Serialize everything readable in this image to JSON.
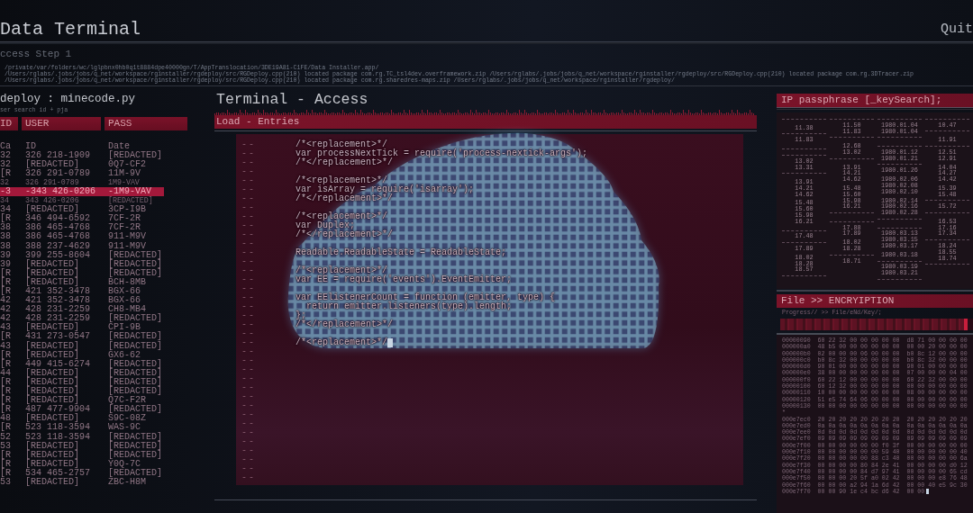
{
  "header": {
    "title": "Data Terminal",
    "quit": "Quit",
    "step": "ccess Step 1",
    "log_lines": [
      "/private/var/folders/wc/lglpbnx0hb0q1t8884dpe40000gn/T/AppTranslocation/3DE19A81-C1FE/Data Installer.app/",
      "/Users/rglabs/.jobs/jobs/q_net/workspace/rginstaller/rgdeploy/src/RGDeploy.cpp(210) located package com.rg.TC_tsl4dev.overframework.zip /Users/rglabs/.jobs/jobs/q_net/workspace/rginstaller/rgdeploy/src/RGDeploy.cpp(210) located package com.rg.3DTracer.zip",
      "/Users/rglabs/.jobs/jobs/q_net/workspace/rginstaller/rgdeploy/src/RGDeploy.cpp(210) located package com.rg.sharedres-maps.zip /Users/rglabs/.jobs/jobs/q_net/workspace/rginstaller/rgdeploy/"
    ]
  },
  "left_panel": {
    "title": "deploy : minecode.py",
    "subtitle": "ser search id + pja",
    "columns": [
      "ID",
      "USER",
      "PASS"
    ],
    "rows": [
      {
        "cells": [
          "Ca",
          "ID",
          "Date"
        ],
        "selected": false,
        "faint": false
      },
      {
        "cells": [
          "32",
          "326 218-1909",
          "[REDACTED]"
        ],
        "selected": false,
        "faint": false
      },
      {
        "cells": [
          "32",
          "[REDACTED]",
          "0Q7-CF2"
        ],
        "selected": false,
        "faint": false
      },
      {
        "cells": [
          "[R",
          "326 291-0789",
          "11M-9V"
        ],
        "selected": false,
        "faint": false
      },
      {
        "cells": [
          "32",
          "326 291-0789",
          "1M9-VAV"
        ],
        "selected": false,
        "faint": true
      },
      {
        "cells": [
          "-3",
          "-343 426-0206",
          "-1M9-VAV"
        ],
        "selected": true,
        "faint": false
      },
      {
        "cells": [
          "34",
          "343 426-0206",
          "[REDACTED]"
        ],
        "selected": false,
        "faint": true
      },
      {
        "cells": [
          "34",
          "[REDACTED]",
          "3CP-I9B"
        ],
        "selected": false,
        "faint": false
      },
      {
        "cells": [
          "[R",
          "346 494-6592",
          "7CF-2R"
        ],
        "selected": false,
        "faint": false
      },
      {
        "cells": [
          "38",
          "386 465-4768",
          "7CF-2R"
        ],
        "selected": false,
        "faint": false
      },
      {
        "cells": [
          "38",
          "386 465-4768",
          "911-M9V"
        ],
        "selected": false,
        "faint": false
      },
      {
        "cells": [
          "38",
          "388 237-4629",
          "911-M9V"
        ],
        "selected": false,
        "faint": false
      },
      {
        "cells": [
          "39",
          "399 255-8604",
          "[REDACTED]"
        ],
        "selected": false,
        "faint": false
      },
      {
        "cells": [
          "39",
          "[REDACTED]",
          "[REDACTED]"
        ],
        "selected": false,
        "faint": false
      },
      {
        "cells": [
          "[R",
          "[REDACTED]",
          "[REDACTED]"
        ],
        "selected": false,
        "faint": false
      },
      {
        "cells": [
          "[R",
          "[REDACTED]",
          "BCH-8MB"
        ],
        "selected": false,
        "faint": false
      },
      {
        "cells": [
          "[R",
          "421 352-3478",
          "BGX-66"
        ],
        "selected": false,
        "faint": false
      },
      {
        "cells": [
          "42",
          "421 352-3478",
          "BGX-66"
        ],
        "selected": false,
        "faint": false
      },
      {
        "cells": [
          "42",
          "428 231-2259",
          "CH8-MB4"
        ],
        "selected": false,
        "faint": false
      },
      {
        "cells": [
          "42",
          "428 231-2259",
          "[REDACTED]"
        ],
        "selected": false,
        "faint": false
      },
      {
        "cells": [
          "43",
          "[REDACTED]",
          "CPI-9B"
        ],
        "selected": false,
        "faint": false
      },
      {
        "cells": [
          "[R",
          "431 273-0547",
          "[REDACTED]"
        ],
        "selected": false,
        "faint": false
      },
      {
        "cells": [
          "43",
          "[REDACTED]",
          "[REDACTED]"
        ],
        "selected": false,
        "faint": false
      },
      {
        "cells": [
          "[R",
          "[REDACTED]",
          "GX6-62"
        ],
        "selected": false,
        "faint": false
      },
      {
        "cells": [
          "[R",
          "449 415-6274",
          "[REDACTED]"
        ],
        "selected": false,
        "faint": false
      },
      {
        "cells": [
          "44",
          "[REDACTED]",
          "[REDACTED]"
        ],
        "selected": false,
        "faint": false
      },
      {
        "cells": [
          "[R",
          "[REDACTED]",
          "[REDACTED]"
        ],
        "selected": false,
        "faint": false
      },
      {
        "cells": [
          "[R",
          "[REDACTED]",
          "[REDACTED]"
        ],
        "selected": false,
        "faint": false
      },
      {
        "cells": [
          "[R",
          "[REDACTED]",
          "Q7C-F2R"
        ],
        "selected": false,
        "faint": false
      },
      {
        "cells": [
          "[R",
          "487 477-9904",
          "[REDACTED]"
        ],
        "selected": false,
        "faint": false
      },
      {
        "cells": [
          "48",
          "[REDACTED]",
          "S9C-08Z"
        ],
        "selected": false,
        "faint": false
      },
      {
        "cells": [
          "[R",
          "523 118-3594",
          "WAS-9C"
        ],
        "selected": false,
        "faint": false
      },
      {
        "cells": [
          "52",
          "523 118-3594",
          "[REDACTED]"
        ],
        "selected": false,
        "faint": false
      },
      {
        "cells": [
          "53",
          "[REDACTED]",
          "[REDACTED]"
        ],
        "selected": false,
        "faint": false
      },
      {
        "cells": [
          "[R",
          "[REDACTED]",
          "[REDACTED]"
        ],
        "selected": false,
        "faint": false
      },
      {
        "cells": [
          "[R",
          "[REDACTED]",
          "Y0Q-7C"
        ],
        "selected": false,
        "faint": false
      },
      {
        "cells": [
          "[R",
          "534 465-2757",
          "[REDACTED]"
        ],
        "selected": false,
        "faint": false
      },
      {
        "cells": [
          "53",
          "[REDACTED]",
          "ZBC-H8M"
        ],
        "selected": false,
        "faint": false
      }
    ]
  },
  "terminal": {
    "title": "Terminal - Access",
    "bar": "Load - Entries",
    "lines": [
      {
        "gutter": "--",
        "code": "/*<replacement>*/",
        "cursor": false
      },
      {
        "gutter": "--",
        "code": "var processNextTick = require('process-nextick-args');",
        "cursor": false
      },
      {
        "gutter": "--",
        "code": "/*</replacement>*/",
        "cursor": false
      },
      {
        "gutter": "--",
        "cursor": false
      },
      {
        "gutter": "--",
        "code": "/*<replacement>*/",
        "cursor": false
      },
      {
        "gutter": "--",
        "code": "var isArray = require('isarray');",
        "cursor": false
      },
      {
        "gutter": "--",
        "code": "/*</replacement>*/",
        "cursor": false
      },
      {
        "gutter": "--",
        "cursor": false
      },
      {
        "gutter": "--",
        "code": "/*<replacement>*/",
        "cursor": false
      },
      {
        "gutter": "--",
        "code": "var Duplex;",
        "cursor": false
      },
      {
        "gutter": "--",
        "code": "/*</replacement>*/",
        "cursor": false
      },
      {
        "gutter": "--",
        "cursor": false
      },
      {
        "gutter": "--",
        "code": "Readable.ReadableState = ReadableState;",
        "cursor": false
      },
      {
        "gutter": "--",
        "cursor": false
      },
      {
        "gutter": "--",
        "code": "/*<replacement>*/",
        "cursor": false
      },
      {
        "gutter": "--",
        "code": "var EE = require('events').EventEmitter;",
        "cursor": false
      },
      {
        "gutter": "--",
        "cursor": false
      },
      {
        "gutter": "--",
        "code": "var EElistenerCount = function (emitter, type) {",
        "cursor": false
      },
      {
        "gutter": "--",
        "code": "  return emitter.listeners(type).length;",
        "cursor": false
      },
      {
        "gutter": "--",
        "code": "};",
        "cursor": false
      },
      {
        "gutter": "--",
        "code": "/*</replacement>*/",
        "cursor": false
      },
      {
        "gutter": "--",
        "cursor": false
      },
      {
        "gutter": "--",
        "code": "/*<replacement>*/",
        "cursor": true
      },
      {
        "gutter": "--",
        "cursor": false
      },
      {
        "gutter": "--",
        "cursor": false
      },
      {
        "gutter": "--",
        "cursor": false
      },
      {
        "gutter": "--",
        "cursor": false
      },
      {
        "gutter": "--",
        "cursor": false
      },
      {
        "gutter": "--",
        "cursor": false
      },
      {
        "gutter": "--",
        "cursor": false
      },
      {
        "gutter": "--",
        "cursor": false
      },
      {
        "gutter": "--",
        "cursor": false
      },
      {
        "gutter": "--",
        "cursor": false
      },
      {
        "gutter": "--",
        "cursor": false
      },
      {
        "gutter": "--",
        "cursor": false
      },
      {
        "gutter": "--",
        "cursor": false
      },
      {
        "gutter": "--",
        "cursor": false
      },
      {
        "gutter": "--",
        "cursor": false
      }
    ]
  },
  "ip_panel": {
    "title": "IP passphrase [_keySearch];",
    "columns": [
      {
        "groups": [
          [
            {
              "kind": "rule"
            }
          ],
          [
            {
              "kind": "value",
              "text": "11.38"
            },
            {
              "kind": "rule"
            },
            {
              "kind": "value",
              "text": "11.83"
            }
          ],
          [
            {
              "kind": "rule"
            },
            {
              "kind": "rule"
            },
            {
              "kind": "value",
              "text": "13.02"
            },
            {
              "kind": "value",
              "text": "13.31"
            },
            {
              "kind": "rule"
            }
          ],
          [
            {
              "kind": "value",
              "text": "13.91"
            },
            {
              "kind": "value",
              "text": "14.21"
            },
            {
              "kind": "value",
              "text": "14.62"
            }
          ],
          [
            {
              "kind": "value",
              "text": "15.48"
            },
            {
              "kind": "value",
              "text": "15.60"
            },
            {
              "kind": "value",
              "text": "15.98"
            },
            {
              "kind": "value",
              "text": "16.21"
            }
          ],
          [
            {
              "kind": "rule"
            },
            {
              "kind": "value",
              "text": "17.48"
            },
            {
              "kind": "rule"
            },
            {
              "kind": "value",
              "text": "17.89"
            }
          ],
          [
            {
              "kind": "value",
              "text": "18.02"
            },
            {
              "kind": "value",
              "text": "18.28"
            },
            {
              "kind": "value",
              "text": "18.57"
            },
            {
              "kind": "rule"
            }
          ]
        ]
      },
      {
        "groups": [
          [
            {
              "kind": "rule"
            },
            {
              "kind": "value",
              "text": "11.50"
            },
            {
              "kind": "value",
              "text": "11.83"
            },
            {
              "kind": "rule"
            }
          ],
          [
            {
              "kind": "value",
              "text": "12.68"
            },
            {
              "kind": "value",
              "text": "13.02"
            },
            {
              "kind": "rule"
            }
          ],
          [
            {
              "kind": "value",
              "text": "13.91"
            },
            {
              "kind": "value",
              "text": "14.21"
            },
            {
              "kind": "value",
              "text": "14.62"
            }
          ],
          [
            {
              "kind": "value",
              "text": "15.48"
            },
            {
              "kind": "value",
              "text": "15.60"
            },
            {
              "kind": "value",
              "text": "15.98"
            },
            {
              "kind": "value",
              "text": "16.21"
            },
            {
              "kind": "rule"
            }
          ],
          [
            {
              "kind": "rule"
            },
            {
              "kind": "value",
              "text": "17.88"
            },
            {
              "kind": "value",
              "text": "17.89"
            }
          ],
          [
            {
              "kind": "value",
              "text": "18.02"
            },
            {
              "kind": "value",
              "text": "18.28"
            },
            {
              "kind": "rule"
            },
            {
              "kind": "value",
              "text": "18.71"
            }
          ]
        ]
      },
      {
        "groups": [
          [
            {
              "kind": "rule"
            },
            {
              "kind": "value",
              "text": "1980.01.04"
            },
            {
              "kind": "value",
              "text": "1980.01.04"
            },
            {
              "kind": "rule"
            }
          ],
          [
            {
              "kind": "rule"
            },
            {
              "kind": "value",
              "text": "1980.01.12"
            },
            {
              "kind": "value",
              "text": "1980.01.21"
            },
            {
              "kind": "rule"
            },
            {
              "kind": "value",
              "text": "1980.01.26"
            }
          ],
          [
            {
              "kind": "value",
              "text": "1980.02.06"
            },
            {
              "kind": "value",
              "text": "1980.02.08"
            },
            {
              "kind": "value",
              "text": "1980.02.10"
            }
          ],
          [
            {
              "kind": "value",
              "text": "1980.02.14"
            },
            {
              "kind": "value",
              "text": "1980.02.16"
            },
            {
              "kind": "value",
              "text": "1980.02.28"
            },
            {
              "kind": "rule"
            }
          ],
          [
            {
              "kind": "rule"
            },
            {
              "kind": "value",
              "text": "1980.03.13"
            },
            {
              "kind": "value",
              "text": "1980.03.15"
            },
            {
              "kind": "value",
              "text": "1980.03.17"
            }
          ],
          [
            {
              "kind": "value",
              "text": "1980.03.18"
            },
            {
              "kind": "rule"
            },
            {
              "kind": "value",
              "text": "1980.03.19"
            },
            {
              "kind": "value",
              "text": "1980.03.21"
            },
            {
              "kind": "rule"
            }
          ]
        ]
      },
      {
        "groups": [
          [
            {
              "kind": "rule"
            },
            {
              "kind": "value",
              "text": "10.47"
            },
            {
              "kind": "rule"
            }
          ],
          [
            {
              "kind": "value",
              "text": "11.91"
            },
            {
              "kind": "rule"
            },
            {
              "kind": "value",
              "text": "12.51"
            },
            {
              "kind": "value",
              "text": "12.91"
            }
          ],
          [
            {
              "kind": "value",
              "text": "14.04"
            },
            {
              "kind": "value",
              "text": "14.27"
            },
            {
              "kind": "value",
              "text": "14.42"
            }
          ],
          [
            {
              "kind": "value",
              "text": "15.39"
            },
            {
              "kind": "value",
              "text": "15.48"
            },
            {
              "kind": "rule"
            },
            {
              "kind": "value",
              "text": "15.72"
            },
            {
              "kind": "rule"
            }
          ],
          [
            {
              "kind": "value",
              "text": "16.53"
            },
            {
              "kind": "value",
              "text": "17.16"
            },
            {
              "kind": "value",
              "text": "17.34"
            },
            {
              "kind": "rule"
            },
            {
              "kind": "value",
              "text": "18.24"
            },
            {
              "kind": "value",
              "text": "18.55"
            },
            {
              "kind": "value",
              "text": "18.74"
            },
            {
              "kind": "rule"
            }
          ]
        ]
      }
    ]
  },
  "file_panel": {
    "title": "File >> ENCRYIPTION",
    "progress_label": "Progress// >> File/eNd/Key/;",
    "progress": {
      "level": 0.97
    },
    "hex_lines": [
      {
        "text": "00000090  60 22 32 00 00 00 00 00  d8 71 00 00 00 00",
        "cursor": false
      },
      {
        "text": "000000a0  48 b5 00 00 00 00 00 00  00 00 20 00 00 00",
        "cursor": false
      },
      {
        "text": "000000b0  02 00 00 00 06 00 00 00  b0 8c 12 00 00 00",
        "cursor": false
      },
      {
        "text": "000000c0  b0 8c 32 00 00 00 00 00  b0 8c 32 00 00 00",
        "cursor": false
      },
      {
        "text": "000000d0  90 01 00 00 00 00 00 00  90 01 00 00 00 00",
        "cursor": false
      },
      {
        "text": "000000e0  38 00 00 00 00 00 00 00  07 00 00 00 04 00",
        "cursor": false
      },
      {
        "text": "000000f0  60 22 12 00 00 00 00 00  60 22 32 00 00 00",
        "cursor": false
      },
      {
        "text": "00000100  60 12 32 00 00 00 00 00  00 00 00 00 00 00",
        "cursor": false
      },
      {
        "text": "00000110  10 00 00 00 00 00 00 00  08 00 00 00 00 00",
        "cursor": false
      },
      {
        "text": "00000120  51 e5 74 64 06 00 00 00  00 00 00 00 00 00",
        "cursor": false
      },
      {
        "text": "00000130  00 00 00 00 00 00 00 00  00 00 00 00 00 00",
        "cursor": false
      },
      {
        "text": "*",
        "cursor": false
      },
      {
        "text": "000e7ec0  20 20 20 20 20 20 20 20  20 20 20 20 20 20",
        "cursor": false
      },
      {
        "text": "000e7ed0  0a 0a 0a 0a 0a 0a 0a 0a  0a 0a 0a 0a 0a 0a",
        "cursor": false
      },
      {
        "text": "000e7ee0  0d 0d 0d 0d 0d 0d 0d 0d  0d 0d 0d 0d 0d 0d",
        "cursor": false
      },
      {
        "text": "000e7ef0  09 09 09 09 09 09 09 09  09 09 09 09 09 09",
        "cursor": false
      },
      {
        "text": "000e7f00  00 00 00 00 00 00 f0 3f  00 00 00 00 00 00",
        "cursor": false
      },
      {
        "text": "000e7f10  00 00 00 00 00 00 59 40  00 00 00 00 00 40",
        "cursor": false
      },
      {
        "text": "000e7f20  00 00 00 00 00 88 c3 40  00 00 00 00 00 6a",
        "cursor": false
      },
      {
        "text": "000e7f30  00 00 00 00 80 84 2e 41  00 00 00 00 d0 12",
        "cursor": false
      },
      {
        "text": "000e7f40  00 00 00 00 84 d7 97 41  00 00 00 00 65 cd",
        "cursor": false
      },
      {
        "text": "000e7f50  00 00 00 20 5f a0 02 42  00 00 00 e8 76 48",
        "cursor": false
      },
      {
        "text": "000e7f60  00 00 00 a2 94 1a 6d 42  00 00 40 e5 9c 30",
        "cursor": false
      },
      {
        "text": "000e7f70  00 00 90 1e c4 bc d6 42  00 00",
        "cursor": true
      }
    ]
  }
}
